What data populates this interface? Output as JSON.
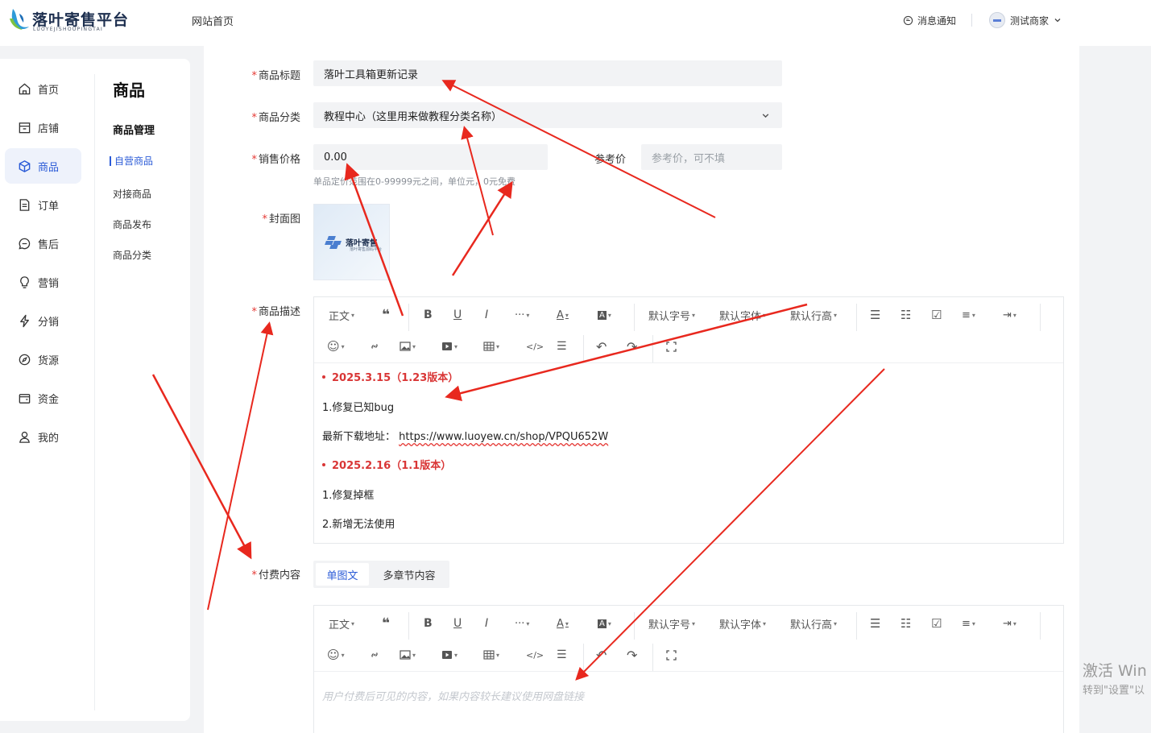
{
  "header": {
    "brand_name": "落叶寄售平台",
    "brand_sub": "LUOYEJISHOUPINGTAI",
    "home_link": "网站首页",
    "notify_label": "消息通知",
    "user_name": "测试商家"
  },
  "nav": {
    "items": [
      {
        "label": "首页",
        "icon": "home-icon"
      },
      {
        "label": "店铺",
        "icon": "store-icon"
      },
      {
        "label": "商品",
        "icon": "cube-icon",
        "active": true
      },
      {
        "label": "订单",
        "icon": "document-icon"
      },
      {
        "label": "售后",
        "icon": "chat-icon"
      },
      {
        "label": "营销",
        "icon": "bulb-icon"
      },
      {
        "label": "分销",
        "icon": "lightning-icon"
      },
      {
        "label": "货源",
        "icon": "compass-icon"
      },
      {
        "label": "资金",
        "icon": "wallet-icon"
      },
      {
        "label": "我的",
        "icon": "user-icon"
      }
    ]
  },
  "subnav": {
    "title": "商品",
    "group": "商品管理",
    "items": [
      "自营商品",
      "对接商品",
      "商品发布",
      "商品分类"
    ]
  },
  "form": {
    "title_label": "商品标题",
    "title_value": "落叶工具箱更新记录",
    "category_label": "商品分类",
    "category_value": "教程中心（这里用来做教程分类名称）",
    "price_label": "销售价格",
    "price_value": "0.00",
    "ref_price_label": "参考价",
    "ref_price_placeholder": "参考价，可不填",
    "price_hint": "单品定价范围在0-99999元之间，单位元，0元免费",
    "cover_label": "封面图",
    "cover_text": "落叶寄售",
    "cover_sub": "落叶寄售源码平台",
    "desc_label": "商品描述",
    "paid_label": "付费内容"
  },
  "toolbar": {
    "paragraph": "正文",
    "font_size": "默认字号",
    "font_family": "默认字体",
    "line_height": "默认行高"
  },
  "description": {
    "lines": [
      {
        "text": "2025.3.15（1.23版本）",
        "style": "red-bullet"
      },
      {
        "text": "1.修复已知bug"
      },
      {
        "text": "最新下载地址：",
        "link": "https://www.luoyew.cn/shop/VPQU652W"
      },
      {
        "text": "2025.2.16（1.1版本）",
        "style": "red-bullet"
      },
      {
        "text": "1.修复掉框"
      },
      {
        "text": "2.新增无法使用"
      }
    ]
  },
  "paid": {
    "tab_single": "单图文",
    "tab_multi": "多章节内容",
    "placeholder": "用户付费后可见的内容，如果内容较长建议使用网盘链接"
  },
  "watermark": {
    "line1": "激活 Win",
    "line2": "转到\"设置\"以"
  },
  "colors": {
    "accent": "#2b5bd7",
    "required": "#e53935",
    "annotation_arrow": "#e8281e"
  }
}
